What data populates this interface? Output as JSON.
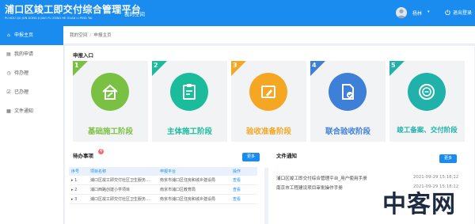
{
  "header": {
    "title": "浦口区竣工即交付综合管理平台",
    "title_pinyin": "PU KOU QU JUN GONG JI JIAO FU ZONG HE GUAN LI PING TAI",
    "nav_item": "我的空间",
    "username": "杨林",
    "caret": "▾",
    "logout_label": "退出登录",
    "brand_color": "#1a8cf0"
  },
  "sidebar": {
    "items": [
      {
        "label": "申报主页",
        "icon": "home-icon",
        "active": true
      },
      {
        "label": "我的申请",
        "icon": "document-icon",
        "active": false
      },
      {
        "label": "待办理",
        "icon": "clock-icon",
        "active": false
      },
      {
        "label": "已办理",
        "icon": "check-icon",
        "active": false
      },
      {
        "label": "文件通知",
        "icon": "notice-icon",
        "active": false
      }
    ]
  },
  "breadcrumb": {
    "items": [
      "我的空间",
      "申报主页"
    ],
    "separator": "/"
  },
  "entry": {
    "title": "申报入口",
    "stages": [
      {
        "num": "1",
        "label": "基础施工阶段",
        "color": "#7ac143",
        "icon": "house-wrench-icon"
      },
      {
        "num": "2",
        "label": "主体施工阶段",
        "color": "#1bbc9b",
        "icon": "clipboard-tools-icon"
      },
      {
        "num": "3",
        "label": "验收准备阶段",
        "color": "#f5a623",
        "icon": "edit-card-icon"
      },
      {
        "num": "4",
        "label": "联合验收阶段",
        "color": "#3e7fd8",
        "icon": "document-check-icon"
      },
      {
        "num": "5",
        "label": "竣工备案、交付阶段",
        "color": "#20b2aa",
        "icon": "seal-icon"
      }
    ]
  },
  "todo": {
    "title": "待办事项",
    "badge": "4",
    "more_label": "更多",
    "columns": [
      "序号",
      "项目名称",
      "申报平台",
      "操作"
    ],
    "rows": [
      {
        "index": "1",
        "name": "浦口区竣工即交付社区卫生服务…",
        "platform": "南京市浦口区住房和城乡建设局",
        "action": "查看"
      },
      {
        "index": "2",
        "name": "浦口西路创建小学项目",
        "platform": "南京市浦口区教育局",
        "action": "查看"
      },
      {
        "index": "3",
        "name": "浦口区竣工即交付社区卫生服务…",
        "platform": "南京市浦口区住房和城乡建设局",
        "action": "查看"
      }
    ]
  },
  "notices": {
    "title": "文件通知",
    "more_label": "更多",
    "items": [
      {
        "title": "浦口区竣工即交付综合管理平台_用户使用手册",
        "date": "2021-09-29 15:18:12"
      },
      {
        "title": "南京市工程建设项目审批操作手册",
        "date": "2021-09-29 15:18:12"
      }
    ]
  },
  "watermark": {
    "text": "中客网"
  }
}
